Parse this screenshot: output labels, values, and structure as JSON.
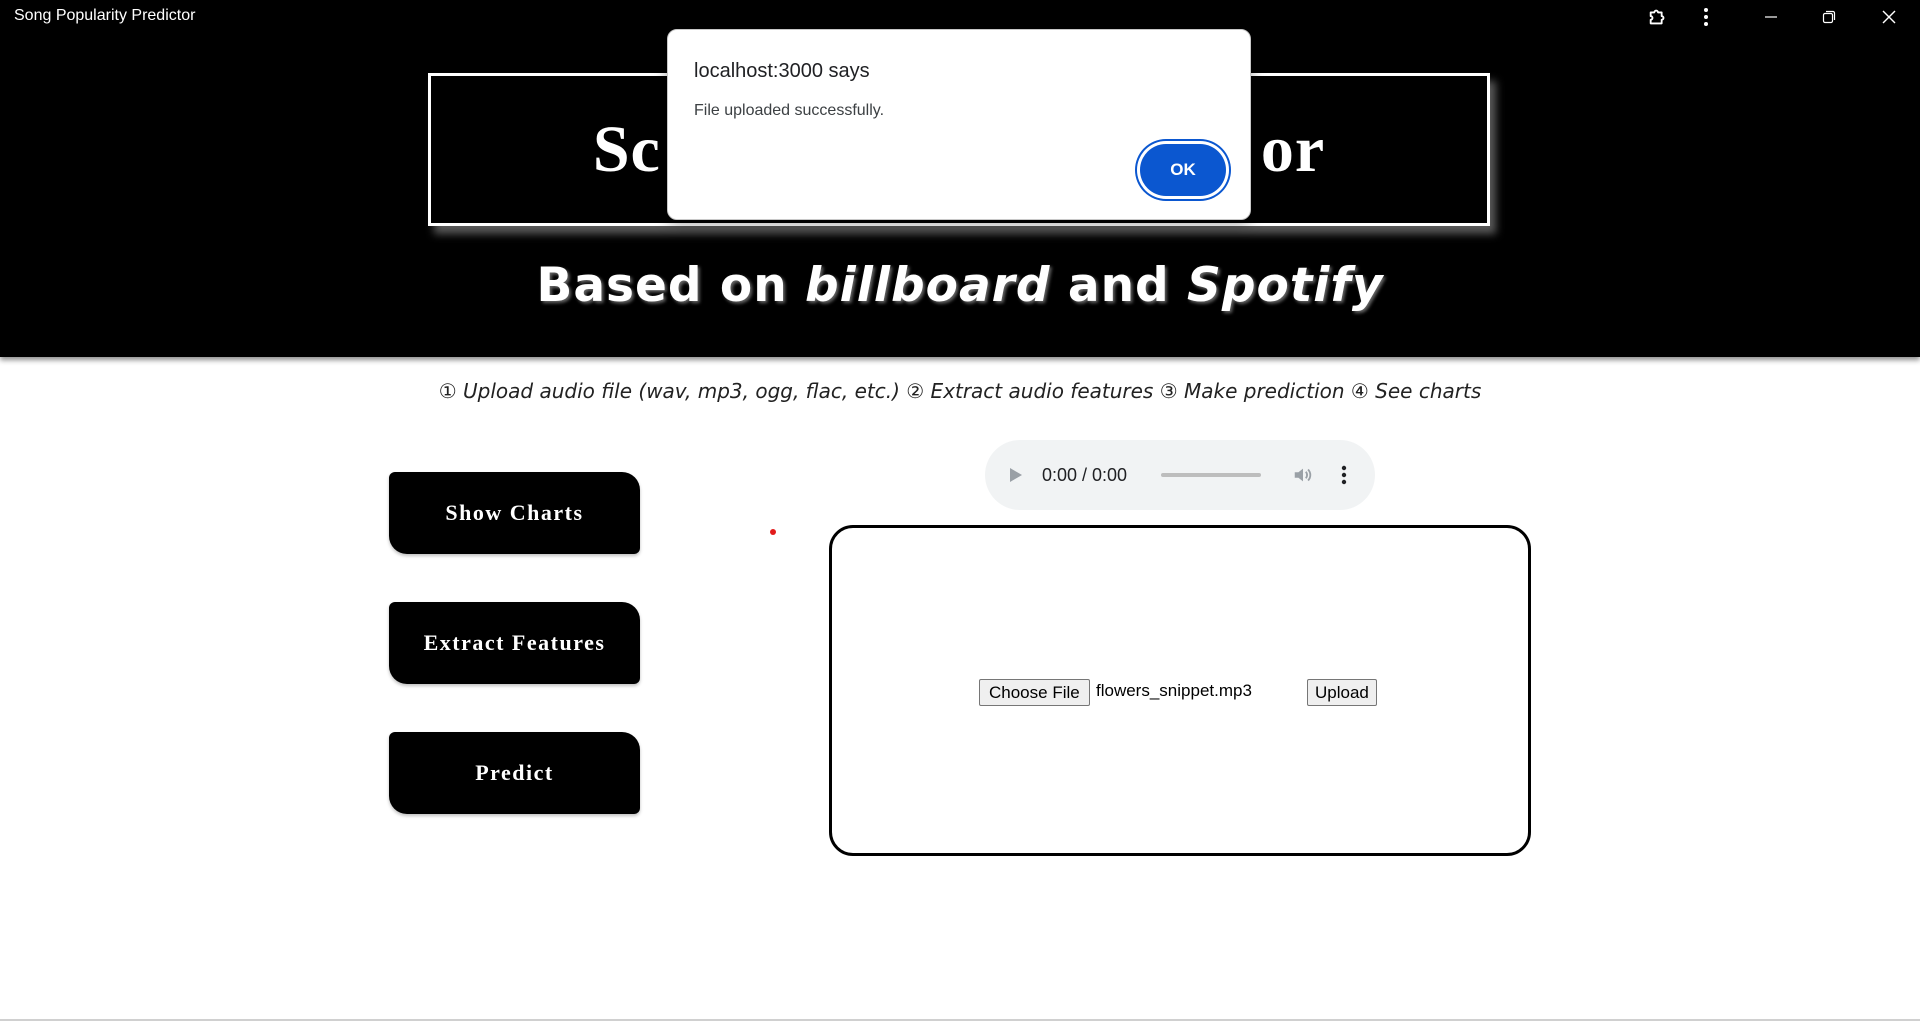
{
  "window": {
    "title": "Song Popularity Predictor",
    "controls": {
      "extensions_icon": "puzzle-icon",
      "menu_icon": "kebab-menu-icon",
      "minimize_icon": "minimize-icon",
      "restore_icon": "restore-icon",
      "close_icon": "close-icon"
    }
  },
  "hero": {
    "title_left": "Sc",
    "title_right": "or",
    "subtitle": {
      "part1": "Based on ",
      "part2": "billboard",
      "part3": " and ",
      "part4": "Spotify"
    },
    "background": "#000000"
  },
  "steps_text": "① Upload audio file (wav, mp3, ogg, flac, etc.) ② Extract audio features ③ Make prediction ④ See charts",
  "actions": {
    "show_charts": "Show Charts",
    "extract_features": "Extract Features",
    "predict": "Predict"
  },
  "audio_player": {
    "time": "0:00 / 0:00",
    "progress": 0,
    "icons": {
      "play": "play-icon",
      "volume": "volume-icon",
      "more": "more-options-icon"
    }
  },
  "upload": {
    "choose_file_label": "Choose File",
    "file_name": "flowers_snippet.mp3",
    "upload_label": "Upload"
  },
  "dialog": {
    "title": "localhost:3000 says",
    "message": "File uploaded successfully.",
    "ok_label": "OK",
    "accent": "#0b57d0"
  }
}
